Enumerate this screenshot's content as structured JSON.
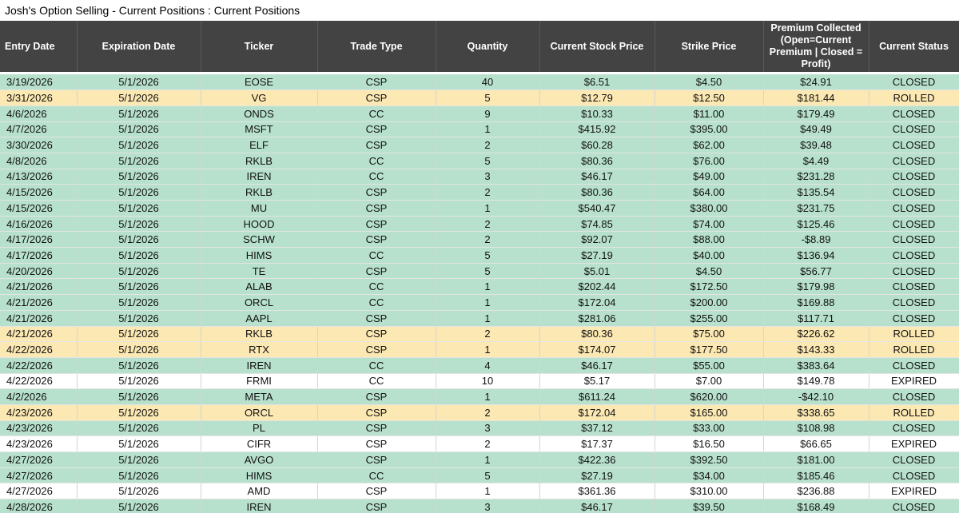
{
  "sheet": {
    "title": "Josh's Option Selling - Current Positions : Current Positions"
  },
  "columns": [
    "Entry Date",
    "Expiration Date",
    "Ticker",
    "Trade Type",
    "Quantity",
    "Current Stock Price",
    "Strike Price",
    "Premium Collected (Open=Current Premium | Closed = Profit)",
    "Current Status"
  ],
  "rows": [
    [
      "3/19/2026",
      "5/1/2026",
      "EOSE",
      "CSP",
      "40",
      "$6.51",
      "$4.50",
      "$24.91",
      "CLOSED"
    ],
    [
      "3/31/2026",
      "5/1/2026",
      "VG",
      "CSP",
      "5",
      "$12.79",
      "$12.50",
      "$181.44",
      "ROLLED"
    ],
    [
      "4/6/2026",
      "5/1/2026",
      "ONDS",
      "CC",
      "9",
      "$10.33",
      "$11.00",
      "$179.49",
      "CLOSED"
    ],
    [
      "4/7/2026",
      "5/1/2026",
      "MSFT",
      "CSP",
      "1",
      "$415.92",
      "$395.00",
      "$49.49",
      "CLOSED"
    ],
    [
      "3/30/2026",
      "5/1/2026",
      "ELF",
      "CSP",
      "2",
      "$60.28",
      "$62.00",
      "$39.48",
      "CLOSED"
    ],
    [
      "4/8/2026",
      "5/1/2026",
      "RKLB",
      "CC",
      "5",
      "$80.36",
      "$76.00",
      "$4.49",
      "CLOSED"
    ],
    [
      "4/13/2026",
      "5/1/2026",
      "IREN",
      "CC",
      "3",
      "$46.17",
      "$49.00",
      "$231.28",
      "CLOSED"
    ],
    [
      "4/15/2026",
      "5/1/2026",
      "RKLB",
      "CSP",
      "2",
      "$80.36",
      "$64.00",
      "$135.54",
      "CLOSED"
    ],
    [
      "4/15/2026",
      "5/1/2026",
      "MU",
      "CSP",
      "1",
      "$540.47",
      "$380.00",
      "$231.75",
      "CLOSED"
    ],
    [
      "4/16/2026",
      "5/1/2026",
      "HOOD",
      "CSP",
      "2",
      "$74.85",
      "$74.00",
      "$125.46",
      "CLOSED"
    ],
    [
      "4/17/2026",
      "5/1/2026",
      "SCHW",
      "CSP",
      "2",
      "$92.07",
      "$88.00",
      "-$8.89",
      "CLOSED"
    ],
    [
      "4/17/2026",
      "5/1/2026",
      "HIMS",
      "CC",
      "5",
      "$27.19",
      "$40.00",
      "$136.94",
      "CLOSED"
    ],
    [
      "4/20/2026",
      "5/1/2026",
      "TE",
      "CSP",
      "5",
      "$5.01",
      "$4.50",
      "$56.77",
      "CLOSED"
    ],
    [
      "4/21/2026",
      "5/1/2026",
      "ALAB",
      "CC",
      "1",
      "$202.44",
      "$172.50",
      "$179.98",
      "CLOSED"
    ],
    [
      "4/21/2026",
      "5/1/2026",
      "ORCL",
      "CC",
      "1",
      "$172.04",
      "$200.00",
      "$169.88",
      "CLOSED"
    ],
    [
      "4/21/2026",
      "5/1/2026",
      "AAPL",
      "CSP",
      "1",
      "$281.06",
      "$255.00",
      "$117.71",
      "CLOSED"
    ],
    [
      "4/21/2026",
      "5/1/2026",
      "RKLB",
      "CSP",
      "2",
      "$80.36",
      "$75.00",
      "$226.62",
      "ROLLED"
    ],
    [
      "4/22/2026",
      "5/1/2026",
      "RTX",
      "CSP",
      "1",
      "$174.07",
      "$177.50",
      "$143.33",
      "ROLLED"
    ],
    [
      "4/22/2026",
      "5/1/2026",
      "IREN",
      "CC",
      "4",
      "$46.17",
      "$55.00",
      "$383.64",
      "CLOSED"
    ],
    [
      "4/22/2026",
      "5/1/2026",
      "FRMI",
      "CC",
      "10",
      "$5.17",
      "$7.00",
      "$149.78",
      "EXPIRED"
    ],
    [
      "4/2/2026",
      "5/1/2026",
      "META",
      "CSP",
      "1",
      "$611.24",
      "$620.00",
      "-$42.10",
      "CLOSED"
    ],
    [
      "4/23/2026",
      "5/1/2026",
      "ORCL",
      "CSP",
      "2",
      "$172.04",
      "$165.00",
      "$338.65",
      "ROLLED"
    ],
    [
      "4/23/2026",
      "5/1/2026",
      "PL",
      "CSP",
      "3",
      "$37.12",
      "$33.00",
      "$108.98",
      "CLOSED"
    ],
    [
      "4/23/2026",
      "5/1/2026",
      "CIFR",
      "CSP",
      "2",
      "$17.37",
      "$16.50",
      "$66.65",
      "EXPIRED"
    ],
    [
      "4/27/2026",
      "5/1/2026",
      "AVGO",
      "CSP",
      "1",
      "$422.36",
      "$392.50",
      "$181.00",
      "CLOSED"
    ],
    [
      "4/27/2026",
      "5/1/2026",
      "HIMS",
      "CC",
      "5",
      "$27.19",
      "$34.00",
      "$185.46",
      "CLOSED"
    ],
    [
      "4/27/2026",
      "5/1/2026",
      "AMD",
      "CSP",
      "1",
      "$361.36",
      "$310.00",
      "$236.88",
      "EXPIRED"
    ],
    [
      "4/28/2026",
      "5/1/2026",
      "IREN",
      "CSP",
      "3",
      "$46.17",
      "$39.50",
      "$168.49",
      "CLOSED"
    ]
  ],
  "colors": {
    "header_bg": "#434343",
    "closed_row": "#b7e1cd",
    "rolled_row": "#fce8b2",
    "expired_row": "#ffffff"
  }
}
